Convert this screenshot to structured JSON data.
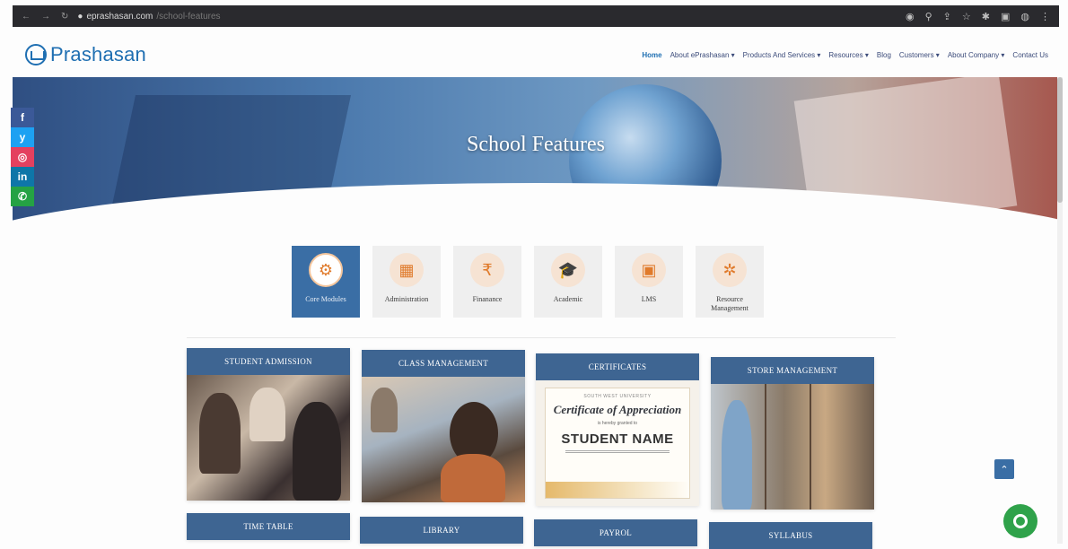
{
  "browser": {
    "url_domain": "eprashasan.com",
    "url_path": "/school-features"
  },
  "site": {
    "logo_text": "Prashasan",
    "menu": [
      {
        "label": "Home",
        "active": true
      },
      {
        "label": "About ePrashasan ▾"
      },
      {
        "label": "Products And Services ▾"
      },
      {
        "label": "Resources ▾"
      },
      {
        "label": "Blog"
      },
      {
        "label": "Customers ▾"
      },
      {
        "label": "About Company ▾"
      },
      {
        "label": "Contact Us"
      }
    ]
  },
  "hero": {
    "title": "School Features"
  },
  "social": [
    "f",
    "y",
    "◎",
    "in",
    "✆"
  ],
  "categories": [
    {
      "label": "Core Modules",
      "icon": "gear-icon",
      "glyph": "⚙",
      "active": true
    },
    {
      "label": "Administration",
      "icon": "admin-icon",
      "glyph": "▦"
    },
    {
      "label": "Finanance",
      "icon": "finance-icon",
      "glyph": "₹"
    },
    {
      "label": "Academic",
      "icon": "graduation-cap-icon",
      "glyph": "🎓"
    },
    {
      "label": "LMS",
      "icon": "lms-icon",
      "glyph": "▣"
    },
    {
      "label": "Resource Management",
      "icon": "resource-icon",
      "glyph": "✲"
    }
  ],
  "features_row1": [
    {
      "title": "Student Admission",
      "image": "students"
    },
    {
      "title": "Class Management",
      "image": "classroom"
    },
    {
      "title": "Certificates",
      "image": "cert"
    },
    {
      "title": "Store Management",
      "image": "store"
    }
  ],
  "certificate": {
    "university": "SOUTH WEST UNIVERSITY",
    "title": "Certificate of Appreciation",
    "subtitle": "is hereby granted to",
    "name": "STUDENT NAME"
  },
  "features_row2": [
    {
      "title": "Time Table"
    },
    {
      "title": "Library"
    },
    {
      "title": "Payrol"
    },
    {
      "title": "Syllabus"
    }
  ],
  "colors": {
    "brand_blue": "#3e6592",
    "logo_blue": "#1f6fb2",
    "accent_orange": "#e07b2c",
    "chat_green": "#2fa24a"
  }
}
